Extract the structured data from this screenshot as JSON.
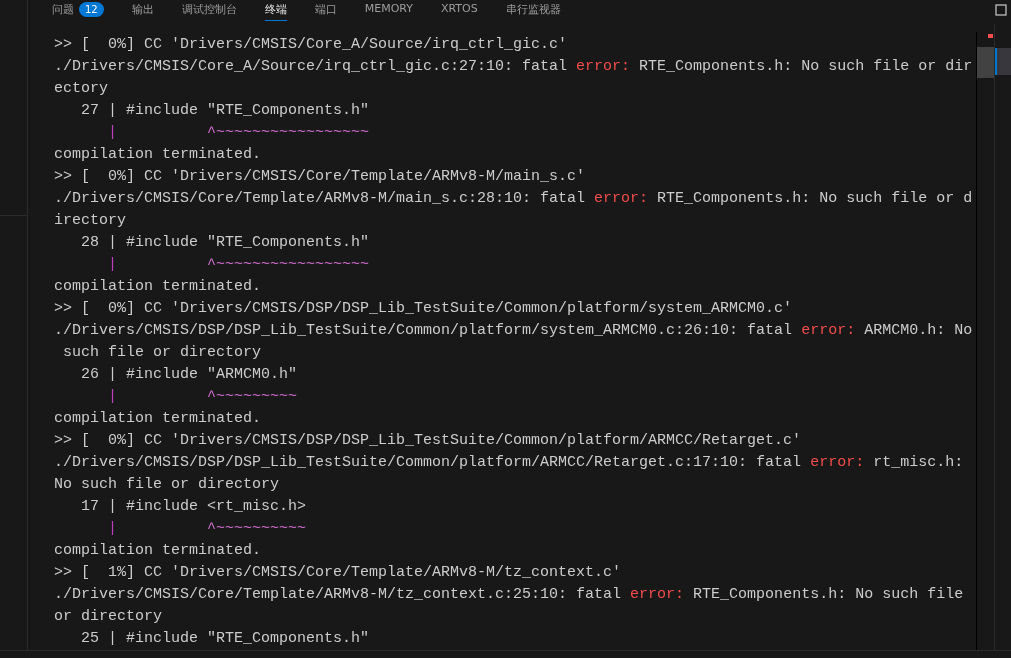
{
  "panel_tabs": [
    {
      "label": "问题",
      "badge": "12",
      "selected": false
    },
    {
      "label": "输出",
      "selected": false
    },
    {
      "label": "调试控制台",
      "selected": false
    },
    {
      "label": "终端",
      "selected": true
    },
    {
      "label": "端口",
      "selected": false
    },
    {
      "label": "MEMORY",
      "selected": false
    },
    {
      "label": "XRTOS",
      "selected": false
    },
    {
      "label": "串行监视器",
      "selected": false
    }
  ],
  "terminal": {
    "lines": [
      {
        "parts": [
          {
            "kind": "text",
            "text": ">> [  0%] CC 'Drivers/CMSIS/Core_A/Source/irq_ctrl_gic.c'"
          }
        ]
      },
      {
        "parts": [
          {
            "kind": "text",
            "text": "./Drivers/CMSIS/Core_A/Source/irq_ctrl_gic.c:27:10: fatal "
          },
          {
            "kind": "error",
            "text": "error:"
          },
          {
            "kind": "text",
            "text": " RTE_Components.h: No such file or dir"
          }
        ]
      },
      {
        "parts": [
          {
            "kind": "text",
            "text": "ectory"
          }
        ]
      },
      {
        "parts": [
          {
            "kind": "text",
            "text": "   27 | #include \"RTE_Components.h\""
          }
        ]
      },
      {
        "parts": [
          {
            "kind": "bar",
            "text": "|"
          },
          {
            "kind": "marker",
            "text": "^~~~~~~~~~~~~~~~~~"
          }
        ]
      },
      {
        "parts": [
          {
            "kind": "text",
            "text": "compilation terminated."
          }
        ]
      },
      {
        "parts": [
          {
            "kind": "text",
            "text": ">> [  0%] CC 'Drivers/CMSIS/Core/Template/ARMv8-M/main_s.c'"
          }
        ]
      },
      {
        "parts": [
          {
            "kind": "text",
            "text": "./Drivers/CMSIS/Core/Template/ARMv8-M/main_s.c:28:10: fatal "
          },
          {
            "kind": "error",
            "text": "error:"
          },
          {
            "kind": "text",
            "text": " RTE_Components.h: No such file or d"
          }
        ]
      },
      {
        "parts": [
          {
            "kind": "text",
            "text": "irectory"
          }
        ]
      },
      {
        "parts": [
          {
            "kind": "text",
            "text": "   28 | #include \"RTE_Components.h\""
          }
        ]
      },
      {
        "parts": [
          {
            "kind": "bar",
            "text": "|"
          },
          {
            "kind": "marker",
            "text": "^~~~~~~~~~~~~~~~~~"
          }
        ]
      },
      {
        "parts": [
          {
            "kind": "text",
            "text": "compilation terminated."
          }
        ]
      },
      {
        "parts": [
          {
            "kind": "text",
            "text": ">> [  0%] CC 'Drivers/CMSIS/DSP/DSP_Lib_TestSuite/Common/platform/system_ARMCM0.c'"
          }
        ]
      },
      {
        "parts": [
          {
            "kind": "text",
            "text": "./Drivers/CMSIS/DSP/DSP_Lib_TestSuite/Common/platform/system_ARMCM0.c:26:10: fatal "
          },
          {
            "kind": "error",
            "text": "error:"
          },
          {
            "kind": "text",
            "text": " ARMCM0.h: No"
          }
        ]
      },
      {
        "parts": [
          {
            "kind": "text",
            "text": " such file or directory"
          }
        ]
      },
      {
        "parts": [
          {
            "kind": "text",
            "text": "   26 | #include \"ARMCM0.h\""
          }
        ]
      },
      {
        "parts": [
          {
            "kind": "bar",
            "text": "|"
          },
          {
            "kind": "marker",
            "text": "^~~~~~~~~~"
          }
        ]
      },
      {
        "parts": [
          {
            "kind": "text",
            "text": "compilation terminated."
          }
        ]
      },
      {
        "parts": [
          {
            "kind": "text",
            "text": ">> [  0%] CC 'Drivers/CMSIS/DSP/DSP_Lib_TestSuite/Common/platform/ARMCC/Retarget.c'"
          }
        ]
      },
      {
        "parts": [
          {
            "kind": "text",
            "text": "./Drivers/CMSIS/DSP/DSP_Lib_TestSuite/Common/platform/ARMCC/Retarget.c:17:10: fatal "
          },
          {
            "kind": "error",
            "text": "error:"
          },
          {
            "kind": "text",
            "text": " rt_misc.h:"
          }
        ]
      },
      {
        "parts": [
          {
            "kind": "text",
            "text": "No such file or directory"
          }
        ]
      },
      {
        "parts": [
          {
            "kind": "text",
            "text": "   17 | #include <rt_misc.h>"
          }
        ]
      },
      {
        "parts": [
          {
            "kind": "bar",
            "text": "|"
          },
          {
            "kind": "marker",
            "text": "^~~~~~~~~~~"
          }
        ]
      },
      {
        "parts": [
          {
            "kind": "text",
            "text": "compilation terminated."
          }
        ]
      },
      {
        "parts": [
          {
            "kind": "text",
            "text": ">> [  1%] CC 'Drivers/CMSIS/Core/Template/ARMv8-M/tz_context.c'"
          }
        ]
      },
      {
        "parts": [
          {
            "kind": "text",
            "text": "./Drivers/CMSIS/Core/Template/ARMv8-M/tz_context.c:25:10: fatal "
          },
          {
            "kind": "error",
            "text": "error:"
          },
          {
            "kind": "text",
            "text": " RTE_Components.h: No such file"
          }
        ]
      },
      {
        "parts": [
          {
            "kind": "text",
            "text": "or directory"
          }
        ]
      },
      {
        "parts": [
          {
            "kind": "text",
            "text": "   25 | #include \"RTE_Components.h\""
          }
        ]
      }
    ]
  }
}
